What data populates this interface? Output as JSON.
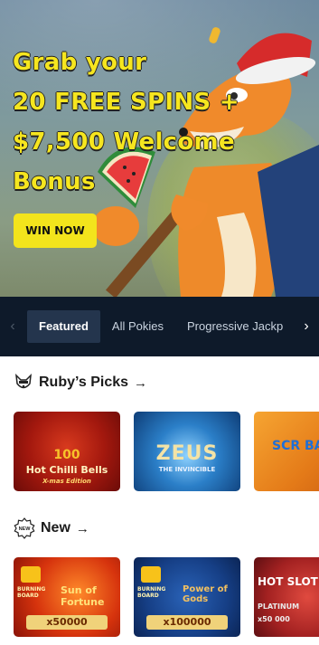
{
  "hero": {
    "title_lines": [
      "Grab your",
      "20 FREE SPINS +",
      "$7,500 Welcome",
      "Bonus"
    ],
    "cta_label": "WIN NOW"
  },
  "tabs": {
    "items": [
      "Featured",
      "All Pokies",
      "Progressive Jackp"
    ],
    "active": "Featured"
  },
  "sections": {
    "picks": {
      "title": "Ruby’s Picks"
    },
    "new": {
      "title": "New",
      "icon_label": "NEW"
    }
  },
  "games": {
    "picks": [
      {
        "name_top": "100",
        "name": "Hot Chilli Bells",
        "sub": "X-mas Edition"
      },
      {
        "name": "ZEUS",
        "sub": "THE INVINCIBLE"
      },
      {
        "name": "SCR BA"
      }
    ],
    "new": [
      {
        "brand": "BURNING BOARD",
        "name": "Sun of Fortune",
        "plate": "x50000"
      },
      {
        "brand": "BURNING BOARD",
        "name": "Power of Gods",
        "plate": "x100000"
      },
      {
        "name": "HOT SLOT",
        "sub": "PLATINUM",
        "plate": "x50 000"
      }
    ]
  },
  "colors": {
    "hero_title": "#f6e61f",
    "cta_bg": "#f3e41c",
    "tabs_bg": "#0e1a2a",
    "tab_active_bg": "#24354d"
  }
}
